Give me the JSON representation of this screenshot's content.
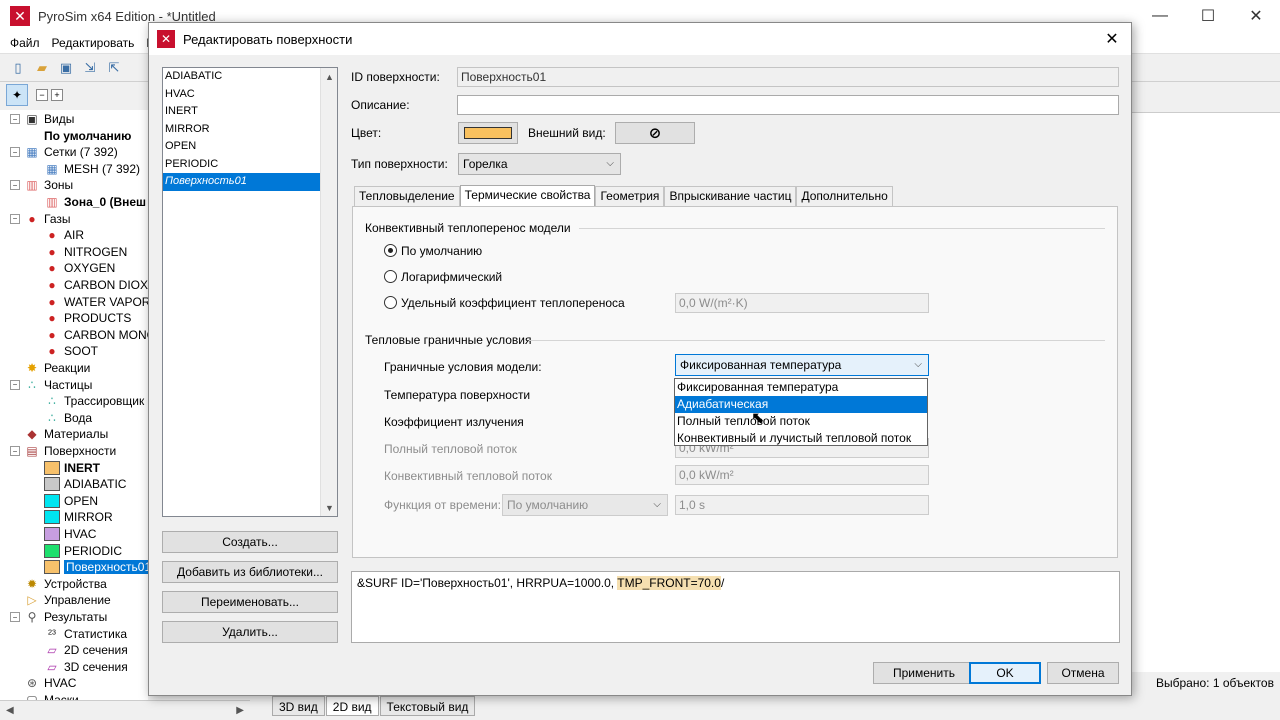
{
  "app": {
    "title": "PyroSim x64 Edition - *Untitled",
    "menu": [
      "Файл",
      "Редактировать",
      "М"
    ],
    "window_controls": [
      "—",
      "☐",
      "✕"
    ]
  },
  "tree": {
    "items": [
      {
        "label": "Виды",
        "icon": "camera-icon",
        "level": 0,
        "exp": "−"
      },
      {
        "label": "По умолчанию",
        "level": 1,
        "bold": true
      },
      {
        "label": "Сетки (7 392)",
        "icon": "mesh-icon",
        "level": 0,
        "exp": "−"
      },
      {
        "label": "MESH (7 392)",
        "icon": "mesh-icon",
        "level": 1
      },
      {
        "label": "Зоны",
        "icon": "zone-icon",
        "level": 0,
        "exp": "−"
      },
      {
        "label": "Зона_0 (Внеш",
        "icon": "zone-icon",
        "level": 1,
        "bold": true
      },
      {
        "label": "Газы",
        "icon": "molecule-icon",
        "level": 0,
        "exp": "−"
      },
      {
        "label": "AIR",
        "icon": "molecule-icon",
        "level": 1
      },
      {
        "label": "NITROGEN",
        "icon": "molecule-icon",
        "level": 1
      },
      {
        "label": "OXYGEN",
        "icon": "molecule-icon",
        "level": 1
      },
      {
        "label": "CARBON DIOXID",
        "icon": "molecule-icon",
        "level": 1
      },
      {
        "label": "WATER VAPOR",
        "icon": "molecule-icon",
        "level": 1
      },
      {
        "label": "PRODUCTS",
        "icon": "molecule-icon",
        "level": 1
      },
      {
        "label": "CARBON MONO",
        "icon": "molecule-icon",
        "level": 1
      },
      {
        "label": "SOOT",
        "icon": "molecule-icon",
        "level": 1
      },
      {
        "label": "Реакции",
        "icon": "reaction-icon",
        "level": 0
      },
      {
        "label": "Частицы",
        "icon": "particles-icon",
        "level": 0,
        "exp": "−"
      },
      {
        "label": "Трассировщик",
        "icon": "particles-icon",
        "level": 1
      },
      {
        "label": "Вода",
        "icon": "particles-icon",
        "level": 1
      },
      {
        "label": "Материалы",
        "icon": "materials-icon",
        "level": 0
      },
      {
        "label": "Поверхности",
        "icon": "surfaces-icon",
        "level": 0,
        "exp": "−"
      },
      {
        "label": "INERT",
        "swatch": "#f7c16b",
        "level": 1,
        "bold": true
      },
      {
        "label": "ADIABATIC",
        "swatch": "#c8c8c8",
        "level": 1
      },
      {
        "label": "OPEN",
        "swatch": "#00e5f0",
        "level": 1
      },
      {
        "label": "MIRROR",
        "swatch": "#00e5f0",
        "level": 1
      },
      {
        "label": "HVAC",
        "swatch": "#c79ee0",
        "level": 1
      },
      {
        "label": "PERIODIC",
        "swatch": "#1ee06e",
        "level": 1
      },
      {
        "label": "Поверхность01",
        "swatch": "#f7c16b",
        "level": 1,
        "selected": true
      },
      {
        "label": "Устройства",
        "icon": "devices-icon",
        "level": 0
      },
      {
        "label": "Управление",
        "icon": "control-icon",
        "level": 0
      },
      {
        "label": "Результаты",
        "icon": "results-icon",
        "level": 0,
        "exp": "−"
      },
      {
        "label": "Статистика",
        "icon": "statistics-icon",
        "level": 1
      },
      {
        "label": "2D сечения",
        "icon": "slice-icon",
        "level": 1
      },
      {
        "label": "3D сечения",
        "icon": "slice-icon",
        "level": 1
      },
      {
        "label": "HVAC",
        "icon": "hvac-icon",
        "level": 0
      },
      {
        "label": "Маски",
        "icon": "mask-icon",
        "level": 0
      }
    ]
  },
  "bottom_tabs": [
    "3D вид",
    "2D вид",
    "Текстовый вид"
  ],
  "status": "Выбрано: 1 объектов",
  "dialog": {
    "title": "Редактировать поверхности",
    "surface_list": [
      "ADIABATIC",
      "HVAC",
      "INERT",
      "MIRROR",
      "OPEN",
      "PERIODIC",
      "Поверхность01"
    ],
    "selected_surface_index": 6,
    "buttons": {
      "create": "Создать...",
      "add_from_library": "Добавить из библиотеки...",
      "rename": "Переименовать...",
      "delete": "Удалить...",
      "apply": "Применить",
      "ok": "OK",
      "cancel": "Отмена"
    },
    "id_label": "ID поверхности:",
    "id_value": "Поверхность01",
    "description_label": "Описание:",
    "description_value": "",
    "color_label": "Цвет:",
    "color_value": "#f9c15f",
    "appearance_label": "Внешний вид:",
    "appearance_icon": "no-texture-icon",
    "type_label": "Тип поверхности:",
    "type_value": "Горелка",
    "tabs": [
      "Тепловыделение",
      "Термические свойства",
      "Геометрия",
      "Впрыскивание частиц",
      "Дополнительно"
    ],
    "active_tab": 1,
    "convective": {
      "group_title": "Конвективный теплоперенос модели",
      "options": [
        "По умолчанию",
        "Логарифмический",
        "Удельный коэффициент теплопереноса"
      ],
      "selected": 0,
      "coef_value": "0,0 W/(m²·K)"
    },
    "thermal_bc": {
      "group_title": "Тепловые граничные условия",
      "model_label": "Граничные условия модели:",
      "model_value": "Фиксированная температура",
      "surface_temp_label": "Температура поверхности",
      "emissivity_label": "Коэффициент излучения",
      "net_heat_flux_label": "Полный тепловой поток",
      "net_heat_flux_value": "0,0 kW/m²",
      "conv_heat_flux_label": "Конвективный тепловой поток",
      "conv_heat_flux_value": "0,0 kW/m²",
      "time_func_label": "Функция от времени:",
      "time_func_value": "По умолчанию",
      "time_value": "1,0 s"
    },
    "dropdown_options": [
      "Фиксированная температура",
      "Адиабатическая",
      "Полный тепловой поток",
      "Конвективный и лучистый тепловой поток"
    ],
    "dropdown_highlight": 1,
    "fds_text_main": "&SURF ID='Поверхность01', HRRPUA=1000.0, ",
    "fds_text_highlight": "TMP_FRONT=70.0",
    "fds_text_end": "/"
  }
}
